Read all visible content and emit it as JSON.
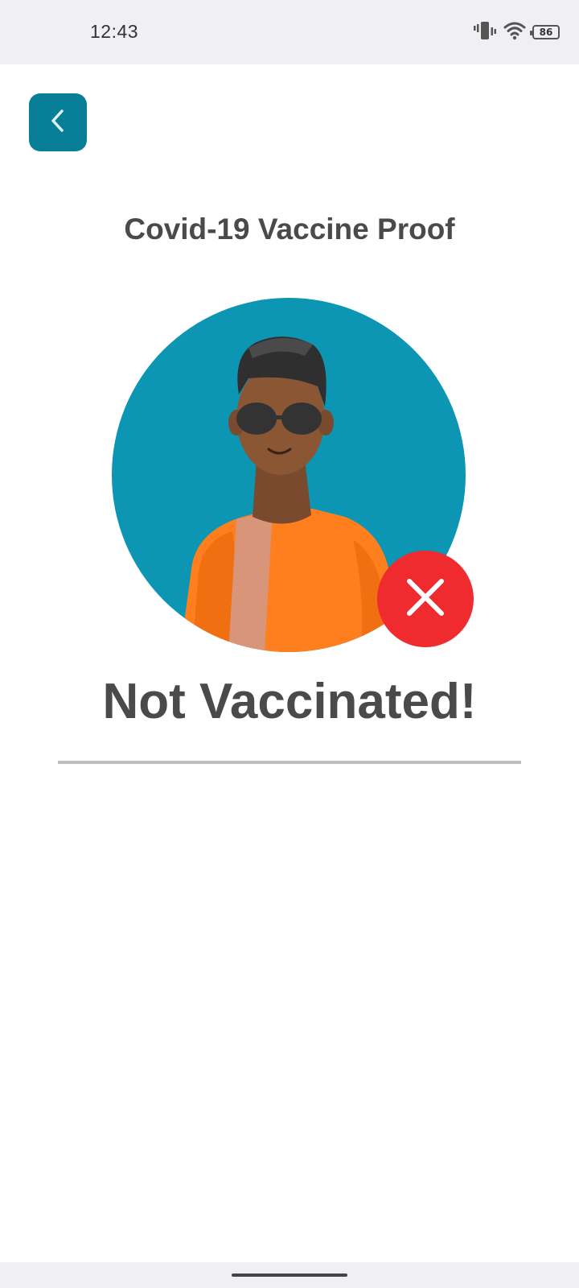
{
  "status_bar": {
    "time": "12:43",
    "battery_level": "86",
    "icons": [
      "vibrate-icon",
      "wifi-icon",
      "battery-icon"
    ]
  },
  "header": {
    "back_icon": "chevron-left-icon",
    "accent_color": "#097f97"
  },
  "main": {
    "title": "Covid-19 Vaccine Proof",
    "avatar_background": "#0c96b3",
    "status_text": "Not Vaccinated!",
    "status_icon": "close-icon",
    "status_color": "#ef2b2f"
  }
}
